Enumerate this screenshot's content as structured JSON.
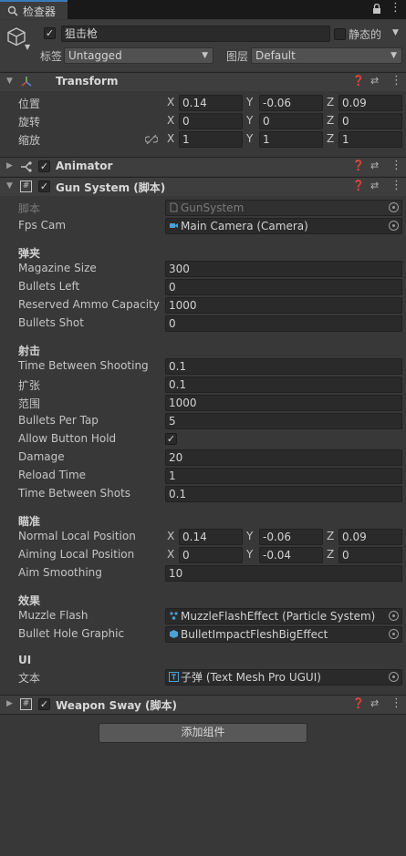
{
  "tab": {
    "title": "检查器",
    "lock_icon": "lock-icon",
    "menu_icon": "kebab-menu-icon"
  },
  "header": {
    "object_name": "狙击枪",
    "static_label": "静态的",
    "tag_label": "标签",
    "tag_value": "Untagged",
    "layer_label": "图层",
    "layer_value": "Default"
  },
  "transform": {
    "title": "Transform",
    "position_label": "位置",
    "rotation_label": "旋转",
    "scale_label": "缩放",
    "position": {
      "x": "0.14",
      "y": "-0.06",
      "z": "0.09"
    },
    "rotation": {
      "x": "0",
      "y": "0",
      "z": "0"
    },
    "scale": {
      "x": "1",
      "y": "1",
      "z": "1"
    },
    "axis": {
      "x": "X",
      "y": "Y",
      "z": "Z"
    }
  },
  "animator": {
    "title": "Animator"
  },
  "gun_system": {
    "title": "Gun System  (脚本)",
    "script_label": "脚本",
    "script_value": "GunSystem",
    "fps_cam_label": "Fps Cam",
    "fps_cam_value": "Main Camera (Camera)",
    "sec_magazine": "弹夹",
    "magazine_size_label": "Magazine Size",
    "magazine_size": "300",
    "bullets_left_label": "Bullets Left",
    "bullets_left": "0",
    "reserved_label": "Reserved Ammo Capacity",
    "reserved": "1000",
    "bullets_shot_label": "Bullets Shot",
    "bullets_shot": "0",
    "sec_shoot": "射击",
    "tbs_label": "Time Between Shooting",
    "tbs": "0.1",
    "spread_label": "扩张",
    "spread": "0.1",
    "range_label": "范围",
    "range": "1000",
    "bpt_label": "Bullets Per Tap",
    "bpt": "5",
    "allow_hold_label": "Allow Button Hold",
    "allow_hold": "✓",
    "damage_label": "Damage",
    "damage": "20",
    "reload_label": "Reload Time",
    "reload": "1",
    "tbshots_label": "Time Between Shots",
    "tbshots": "0.1",
    "sec_aim": "瞄准",
    "normal_pos_label": "Normal Local Position",
    "normal_pos": {
      "x": "0.14",
      "y": "-0.06",
      "z": "0.09"
    },
    "aim_pos_label": "Aiming Local Position",
    "aim_pos": {
      "x": "0",
      "y": "-0.04",
      "z": "0"
    },
    "aim_smooth_label": "Aim Smoothing",
    "aim_smooth": "10",
    "sec_effect": "效果",
    "muzzle_label": "Muzzle Flash",
    "muzzle_value": "MuzzleFlashEffect (Particle System)",
    "hole_label": "Bullet Hole Graphic",
    "hole_value": "BulletImpactFleshBigEffect",
    "sec_ui": "UI",
    "text_label": "文本",
    "text_value": "子弹 (Text Mesh Pro UGUI)"
  },
  "weapon_sway": {
    "title": "Weapon Sway  (脚本)"
  },
  "add_component": "添加组件",
  "colors": {
    "accent": "#3a79bb",
    "background": "#383838",
    "field": "#2a2a2a"
  }
}
